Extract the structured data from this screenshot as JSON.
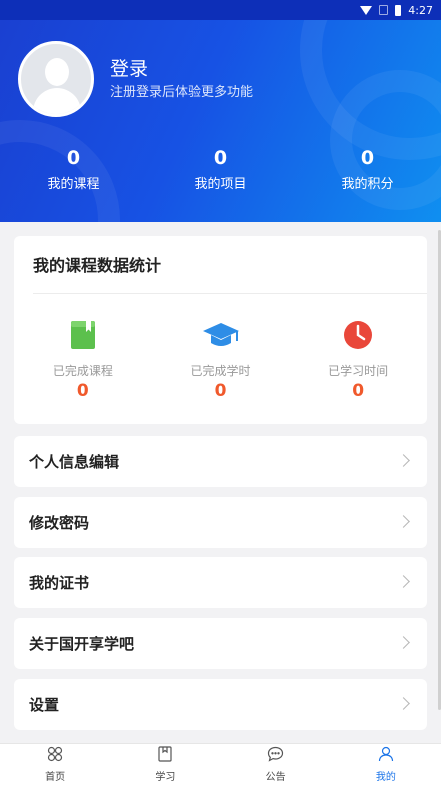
{
  "status_bar": {
    "time": "4:27"
  },
  "profile": {
    "name": "登录",
    "subtitle": "注册登录后体验更多功能"
  },
  "header_stats": [
    {
      "value": "0",
      "label": "我的课程"
    },
    {
      "value": "0",
      "label": "我的项目"
    },
    {
      "value": "0",
      "label": "我的积分"
    }
  ],
  "course_stats": {
    "title": "我的课程数据统计",
    "items": [
      {
        "label": "已完成课程",
        "value": "0",
        "icon": "book-icon",
        "color": "#5cc04d"
      },
      {
        "label": "已完成学时",
        "value": "0",
        "icon": "graduation-cap-icon",
        "color": "#2e8de6"
      },
      {
        "label": "已学习时间",
        "value": "0",
        "icon": "clock-icon",
        "color": "#e9473a"
      }
    ]
  },
  "menu": [
    {
      "label": "个人信息编辑"
    },
    {
      "label": "修改密码"
    },
    {
      "label": "我的证书"
    },
    {
      "label": "关于国开享学吧"
    },
    {
      "label": "设置"
    }
  ],
  "tabs": [
    {
      "label": "首页",
      "icon": "home-icon",
      "active": false
    },
    {
      "label": "学习",
      "icon": "book-outline-icon",
      "active": false
    },
    {
      "label": "公告",
      "icon": "chat-bubble-icon",
      "active": false
    },
    {
      "label": "我的",
      "icon": "user-icon",
      "active": true
    }
  ],
  "colors": {
    "accent": "#1b74e8",
    "stat_value": "#f0592c",
    "header_start": "#1a3fd0",
    "header_end": "#0f8ff0"
  }
}
